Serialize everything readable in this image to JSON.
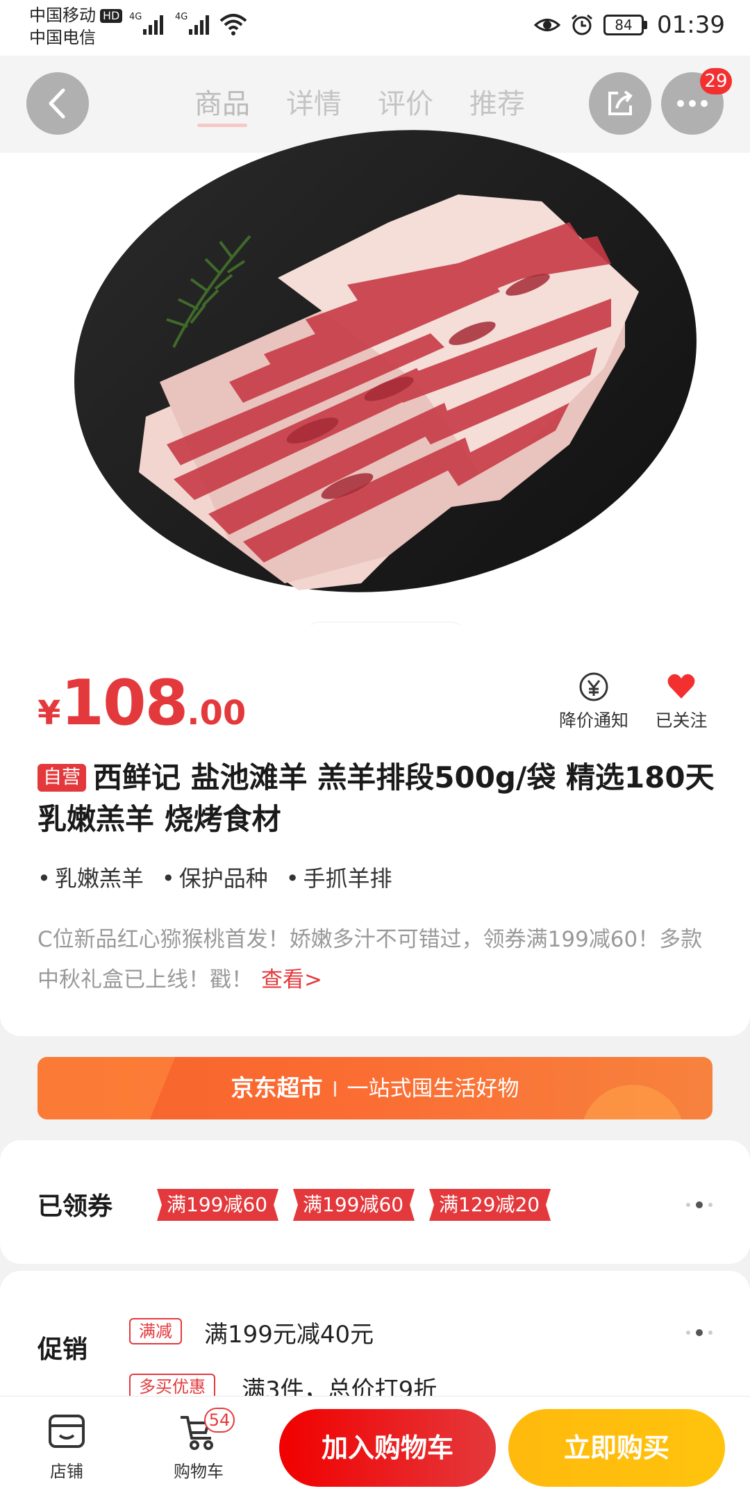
{
  "status_bar": {
    "carrier1": "中国移动",
    "hd": "HD",
    "carrier2": "中国电信",
    "signal_label": "4G",
    "battery": "84",
    "time": "01:39"
  },
  "nav": {
    "tabs": [
      "商品",
      "详情",
      "评价",
      "推荐"
    ],
    "message_count": "29"
  },
  "product": {
    "currency": "¥",
    "price_int": "108",
    "price_dec": ".00",
    "price_notify_label": "降价通知",
    "follow_label": "已关注",
    "self_tag": "自营",
    "title": "西鲜记 盐池滩羊 羔羊排段500g/袋 精选180天乳嫩羔羊 烧烤食材",
    "features": [
      "乳嫩羔羊",
      "保护品种",
      "手抓羊排"
    ],
    "promo_text": "C位新品红心猕猴桃首发！娇嫩多汁不可错过，领券满199减60！多款中秋礼盒已上线！戳！",
    "promo_link": "查看>"
  },
  "banner": {
    "brand": "京东超市",
    "slogan": "一站式囤生活好物"
  },
  "coupons": {
    "label": "已领券",
    "items": [
      "满199减60",
      "满199减60",
      "满129减20"
    ]
  },
  "promotions": {
    "label": "促销",
    "items": [
      {
        "tag": "满减",
        "text": "满199元减40元"
      },
      {
        "tag": "多买优惠",
        "text": "满3件，总价打9折"
      }
    ]
  },
  "bottom_bar": {
    "store_label": "店铺",
    "cart_label": "购物车",
    "cart_count": "54",
    "add_to_cart": "加入购物车",
    "buy_now": "立即购买"
  },
  "colors": {
    "accent": "#e4393c",
    "buy": "#ffc30d",
    "banner": "#f5632a"
  }
}
